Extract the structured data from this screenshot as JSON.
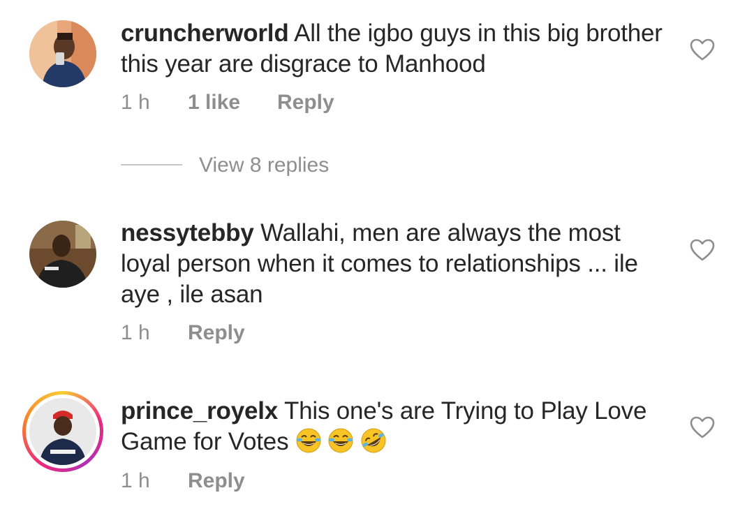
{
  "comments": [
    {
      "username": "cruncherworld",
      "text": "All the igbo guys in this big brother this year are disgrace to Manhood",
      "time": "1 h",
      "likes": "1 like",
      "reply_label": "Reply",
      "view_replies": "View 8 replies",
      "avatar_icon": "avatar-photo-icon",
      "story_ring": false
    },
    {
      "username": "nessytebby",
      "text": "Wallahi, men are always the most loyal person when it comes to relationships ... ile aye , ile asan",
      "time": "1 h",
      "reply_label": "Reply",
      "avatar_icon": "avatar-photo-icon",
      "story_ring": false
    },
    {
      "username": "prince_royelx",
      "text": "This one's are Trying to Play Love Game for Votes",
      "emojis": [
        "😂",
        "😂",
        "🤣"
      ],
      "time": "1 h",
      "reply_label": "Reply",
      "avatar_icon": "avatar-photo-icon",
      "story_ring": true
    }
  ],
  "icons": {
    "like": "heart-outline-icon",
    "emoji_laugh": "face-with-tears-of-joy-icon",
    "emoji_rofl": "rolling-on-the-floor-laughing-icon"
  },
  "colors": {
    "text": "#262626",
    "secondary": "#8e8e8e",
    "divider": "#c7c7c7",
    "story_ring_start": "#f9ce34",
    "story_ring_end": "#ee2a7b"
  }
}
